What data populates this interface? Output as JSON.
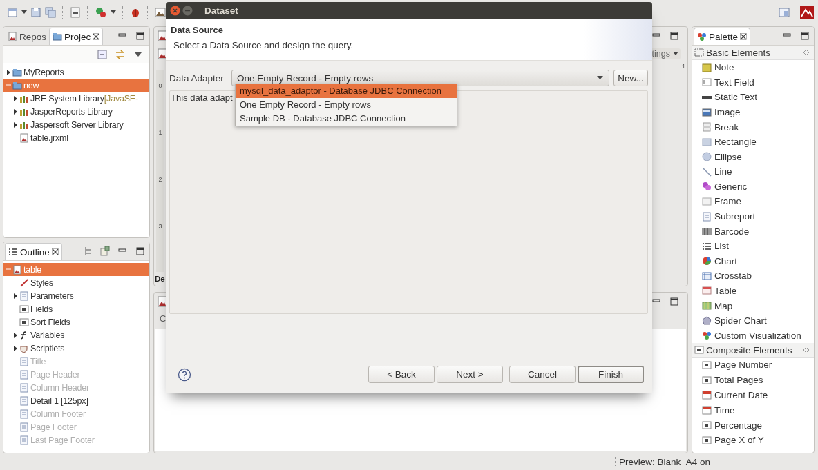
{
  "project_panel": {
    "tabs": [
      {
        "label": "Repos",
        "selected": false
      },
      {
        "label": "Projec",
        "selected": true
      }
    ],
    "tree": [
      {
        "label": "MyReports",
        "kind": "folder",
        "expanded": false,
        "selected": false
      },
      {
        "label": "new",
        "kind": "folder",
        "expanded": true,
        "selected": true,
        "children": [
          {
            "label": "JRE System Library",
            "decoration": "[JavaSE-",
            "kind": "folder",
            "expanded": false,
            "selected": false
          },
          {
            "label": "JasperReports Library",
            "kind": "folder",
            "expanded": false,
            "selected": false
          },
          {
            "label": "Jaspersoft Server Library",
            "kind": "folder",
            "expanded": false,
            "selected": false
          },
          {
            "label": "table.jrxml",
            "kind": "leaf",
            "selected": false
          }
        ]
      }
    ]
  },
  "outline_panel": {
    "tabs": [
      {
        "label": "Outline",
        "selected": true
      }
    ],
    "tree": [
      {
        "label": "table",
        "kind": "folder",
        "expanded": true,
        "selected": true,
        "children": [
          {
            "label": "Styles",
            "kind": "leaf",
            "selected": false,
            "disabled": false
          },
          {
            "label": "Parameters",
            "kind": "folder",
            "expanded": false,
            "selected": false,
            "disabled": false
          },
          {
            "label": "Fields",
            "kind": "leaf",
            "selected": false,
            "disabled": false
          },
          {
            "label": "Sort Fields",
            "kind": "leaf",
            "selected": false,
            "disabled": false
          },
          {
            "label": "Variables",
            "kind": "folder",
            "expanded": false,
            "selected": false,
            "disabled": false
          },
          {
            "label": "Scriptlets",
            "kind": "folder",
            "expanded": false,
            "selected": false,
            "disabled": false
          },
          {
            "label": "Title",
            "kind": "leaf",
            "selected": false,
            "disabled": true
          },
          {
            "label": "Page Header",
            "kind": "leaf",
            "selected": false,
            "disabled": true
          },
          {
            "label": "Column Header",
            "kind": "leaf",
            "selected": false,
            "disabled": true
          },
          {
            "label": "Detail 1 [125px]",
            "kind": "leaf",
            "selected": false,
            "disabled": false
          },
          {
            "label": "Column Footer",
            "kind": "leaf",
            "selected": false,
            "disabled": true
          },
          {
            "label": "Page Footer",
            "kind": "leaf",
            "selected": false,
            "disabled": true
          },
          {
            "label": "Last Page Footer",
            "kind": "leaf",
            "selected": false,
            "disabled": true
          }
        ]
      }
    ]
  },
  "editor": {
    "dropdown": "tings",
    "ruler_mark": "1",
    "ruler_labels": [
      "0",
      "1",
      "2",
      "3"
    ],
    "tab": "De"
  },
  "bottom_panel": {
    "tab": "C"
  },
  "palette": {
    "tabs": [
      {
        "label": "Palette",
        "selected": true
      }
    ],
    "sections": [
      {
        "label": "Basic Elements",
        "expanded": true,
        "items": [
          "Note",
          "Text Field",
          "Static Text",
          "Image",
          "Break",
          "Rectangle",
          "Ellipse",
          "Line",
          "Generic",
          "Frame",
          "Subreport",
          "Barcode",
          "List",
          "Chart",
          "Crosstab",
          "Table",
          "Map",
          "Spider Chart",
          "Custom Visualization"
        ]
      },
      {
        "label": "Composite Elements",
        "expanded": true,
        "items": [
          "Page Number",
          "Total Pages",
          "Current Date",
          "Time",
          "Percentage",
          "Page X of Y"
        ]
      }
    ]
  },
  "status_bar": {
    "text": "Preview: Blank_A4 on"
  },
  "dialog": {
    "title": "Dataset",
    "header": {
      "title": "Data Source",
      "description": "Select a Data Source and design the query."
    },
    "adapter": {
      "label": "Data Adapter",
      "value": "One Empty Record - Empty rows",
      "new_button": "New...",
      "open": true,
      "options": [
        {
          "label": "mysql_data_adaptor - Database JDBC Connection",
          "highlighted": true
        },
        {
          "label": "One Empty Record - Empty rows",
          "highlighted": false
        },
        {
          "label": "Sample DB - Database JDBC Connection",
          "highlighted": false
        }
      ],
      "description": "This data adapt"
    },
    "buttons": [
      {
        "label": "< Back",
        "default": false
      },
      {
        "label": "Next >",
        "default": false
      },
      {
        "label": "Cancel",
        "default": false
      },
      {
        "label": "Finish",
        "default": true
      }
    ]
  }
}
